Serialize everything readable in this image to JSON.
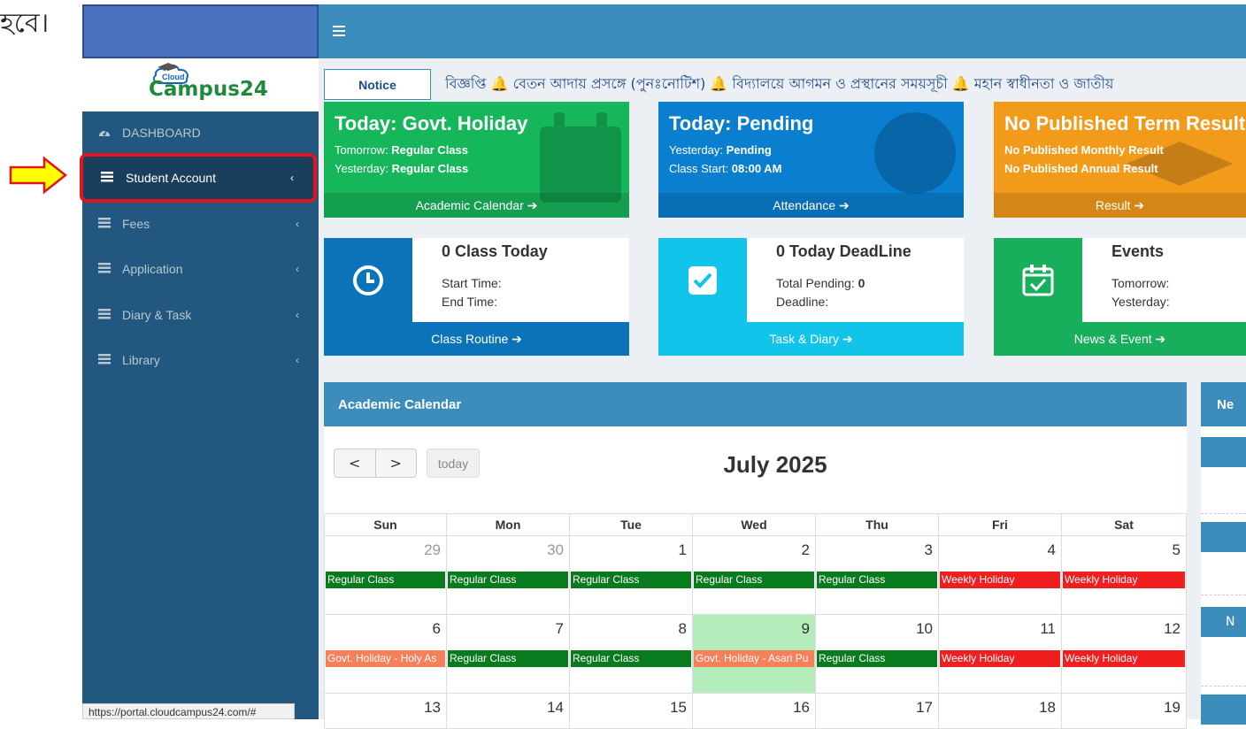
{
  "fragment_text": "হবে।",
  "header": {
    "menu_icon": "bars-icon"
  },
  "logo": {
    "cloud_word": "Cloud",
    "name": "Campus24"
  },
  "sidebar": {
    "items": [
      {
        "label": "DASHBOARD",
        "icon": "dashboard-icon"
      },
      {
        "label": "Student Account",
        "icon": "list-icon",
        "chevron": "‹"
      },
      {
        "label": "Fees",
        "icon": "list-icon",
        "chevron": "‹"
      },
      {
        "label": "Application",
        "icon": "list-icon",
        "chevron": "‹"
      },
      {
        "label": "Diary & Task",
        "icon": "list-icon",
        "chevron": "‹"
      },
      {
        "label": "Library",
        "icon": "list-icon",
        "chevron": "‹"
      }
    ]
  },
  "status_url": "https://portal.cloudcampus24.com/#",
  "notice": {
    "button": "Notice",
    "ticker": "বিজ্ঞপ্তি  🔔 বেতন আদায় প্রসঙ্গে (পুনঃনোটিশ)  🔔 বিদ্যালয়ে আগমন ও প্রস্থানের সময়সূচী  🔔 মহান স্বাধীনতা ও জাতীয়"
  },
  "stats": {
    "holiday": {
      "title": "Today: Govt. Holiday",
      "l1_key": "Tomorrow: ",
      "l1_val": "Regular Class",
      "l2_key": "Yesterday: ",
      "l2_val": "Regular Class",
      "footer": "Academic Calendar ➔"
    },
    "pending": {
      "title": "Today: Pending",
      "l1_key": "Yesterday: ",
      "l1_val": "Pending",
      "l2_key": "Class Start: ",
      "l2_val": "08:00 AM",
      "footer": "Attendance ➔"
    },
    "result": {
      "title": "No Published Term Result",
      "l1": "No Published Monthly Result",
      "l2": "No Published Annual Result",
      "footer": "Result ➔"
    }
  },
  "info": {
    "class": {
      "title": "0 Class Today",
      "r1": "Start Time:",
      "r2": "End Time:",
      "footer": "Class Routine ➔"
    },
    "deadline": {
      "title": "0 Today DeadLine",
      "r1_key": "Total Pending: ",
      "r1_val": "0",
      "r2": "Deadline:",
      "footer": "Task & Diary ➔"
    },
    "events": {
      "title": "Events",
      "r1": "Tomorrow:",
      "r2": "Yesterday:",
      "footer": "News & Event ➔"
    }
  },
  "calendar": {
    "panel_title": "Academic Calendar",
    "prev": "<",
    "next": ">",
    "today_btn": "today",
    "month_title": "July 2025",
    "days_of_week": [
      "Sun",
      "Mon",
      "Tue",
      "Wed",
      "Thu",
      "Fri",
      "Sat"
    ],
    "weeks": [
      [
        {
          "day": "29",
          "other": true,
          "event": "Regular Class",
          "kind": "green"
        },
        {
          "day": "30",
          "other": true,
          "event": "Regular Class",
          "kind": "green"
        },
        {
          "day": "1",
          "event": "Regular Class",
          "kind": "green"
        },
        {
          "day": "2",
          "event": "Regular Class",
          "kind": "green"
        },
        {
          "day": "3",
          "event": "Regular Class",
          "kind": "green"
        },
        {
          "day": "4",
          "event": "Weekly Holiday",
          "kind": "red"
        },
        {
          "day": "5",
          "event": "Weekly Holiday",
          "kind": "red"
        }
      ],
      [
        {
          "day": "6",
          "event": "Govt. Holiday - Holy As",
          "kind": "orange"
        },
        {
          "day": "7",
          "event": "Regular Class",
          "kind": "green"
        },
        {
          "day": "8",
          "event": "Regular Class",
          "kind": "green"
        },
        {
          "day": "9",
          "event": "Govt. Holiday - Asari Pu",
          "kind": "orange",
          "today": true
        },
        {
          "day": "10",
          "event": "Regular Class",
          "kind": "green"
        },
        {
          "day": "11",
          "event": "Weekly Holiday",
          "kind": "red"
        },
        {
          "day": "12",
          "event": "Weekly Holiday",
          "kind": "red"
        }
      ],
      [
        {
          "day": "13"
        },
        {
          "day": "14"
        },
        {
          "day": "15"
        },
        {
          "day": "16"
        },
        {
          "day": "17"
        },
        {
          "day": "18"
        },
        {
          "day": "19"
        }
      ]
    ]
  },
  "right_panel": {
    "title": "Ne",
    "letter": "N"
  },
  "colors": {
    "topbar": "#3c8dbc",
    "sidebar": "#22587f",
    "highlight_border": "#e0161c",
    "arrow": "#ffff00"
  }
}
